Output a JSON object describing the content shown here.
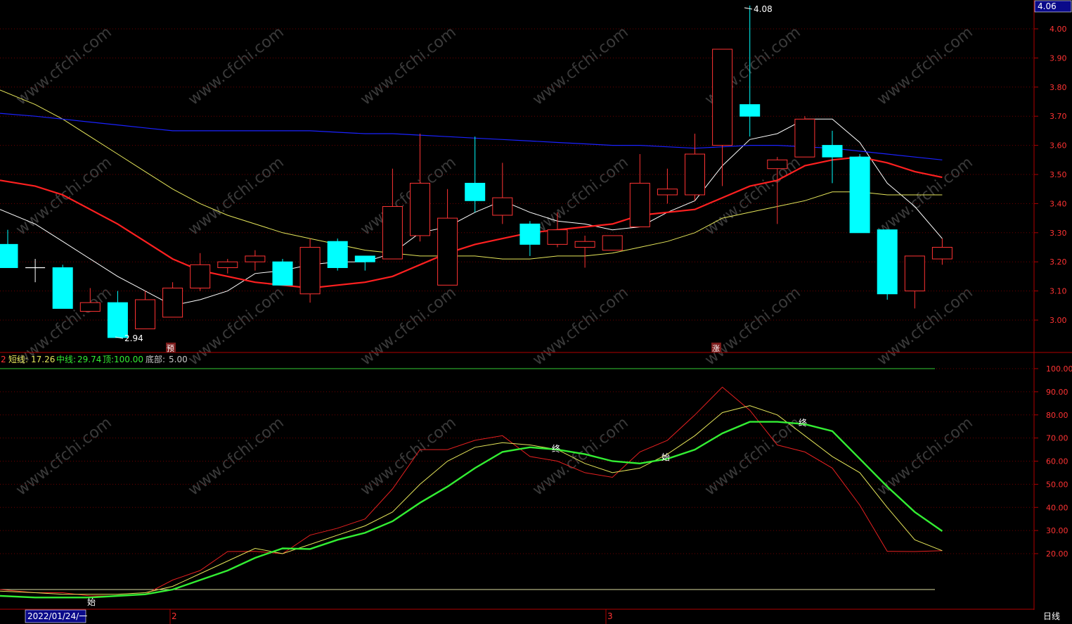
{
  "colors": {
    "up": "#ff3333",
    "down": "#00ffff",
    "grid": "#6e0000",
    "border": "#b00000",
    "axis_text": "#ff3333",
    "ma_short": "#ffffff",
    "ma_mid": "#ff2020",
    "ma_slow": "#e6e65a",
    "ma_long": "#1a22ff",
    "ind_short": "#e62020",
    "ind_mid_thin": "#e6e65a",
    "ind_mid": "#33ee33",
    "ref_top": "#33cc33",
    "ref_bottom": "#dcdca0"
  },
  "header": {
    "price_box": "4.06"
  },
  "price_panel": {
    "high_label": "4.08",
    "low_label": "2.94",
    "markers": [
      "预",
      "涨"
    ]
  },
  "indicator_panel": {
    "legend": [
      {
        "label": "2",
        "value": ""
      },
      {
        "label": "短线:",
        "value": "17.26"
      },
      {
        "label": "中线:",
        "value": "29.74"
      },
      {
        "label": "顶:",
        "value": "100.00"
      },
      {
        "label": "底部:",
        "value": "5.00"
      }
    ],
    "marks": [
      "始",
      "终",
      "始",
      "终"
    ]
  },
  "x_axis": {
    "date_box": "2022/01/24/一",
    "month_labels": [
      "2",
      "3"
    ]
  },
  "period_label": "日线",
  "watermark": "www.cfchi.com",
  "chart_data": [
    {
      "type": "candlestick",
      "ylim": [
        2.9,
        4.1
      ],
      "yticks": [
        3.0,
        3.1,
        3.2,
        3.3,
        3.4,
        3.5,
        3.6,
        3.7,
        3.8,
        3.9,
        4.0
      ],
      "candles": [
        {
          "o": 3.26,
          "c": 3.18,
          "h": 3.31,
          "l": 3.18
        },
        {
          "o": 3.18,
          "c": 3.18,
          "h": 3.21,
          "l": 3.13
        },
        {
          "o": 3.18,
          "c": 3.04,
          "h": 3.19,
          "l": 3.04
        },
        {
          "o": 3.03,
          "c": 3.06,
          "h": 3.11,
          "l": 3.03
        },
        {
          "o": 3.06,
          "c": 2.94,
          "h": 3.1,
          "l": 2.94
        },
        {
          "o": 2.97,
          "c": 3.07,
          "h": 3.1,
          "l": 2.97
        },
        {
          "o": 3.01,
          "c": 3.11,
          "h": 3.13,
          "l": 3.01
        },
        {
          "o": 3.11,
          "c": 3.19,
          "h": 3.23,
          "l": 3.1
        },
        {
          "o": 3.18,
          "c": 3.2,
          "h": 3.21,
          "l": 3.16
        },
        {
          "o": 3.2,
          "c": 3.22,
          "h": 3.24,
          "l": 3.17
        },
        {
          "o": 3.2,
          "c": 3.12,
          "h": 3.21,
          "l": 3.12
        },
        {
          "o": 3.09,
          "c": 3.25,
          "h": 3.28,
          "l": 3.06
        },
        {
          "o": 3.27,
          "c": 3.18,
          "h": 3.28,
          "l": 3.17
        },
        {
          "o": 3.22,
          "c": 3.2,
          "h": 3.22,
          "l": 3.17
        },
        {
          "o": 3.21,
          "c": 3.39,
          "h": 3.52,
          "l": 3.21
        },
        {
          "o": 3.29,
          "c": 3.47,
          "h": 3.64,
          "l": 3.27
        },
        {
          "o": 3.12,
          "c": 3.35,
          "h": 3.45,
          "l": 3.12
        },
        {
          "o": 3.47,
          "c": 3.41,
          "h": 3.63,
          "l": 3.37
        },
        {
          "o": 3.36,
          "c": 3.42,
          "h": 3.54,
          "l": 3.33
        },
        {
          "o": 3.33,
          "c": 3.26,
          "h": 3.34,
          "l": 3.22
        },
        {
          "o": 3.26,
          "c": 3.31,
          "h": 3.37,
          "l": 3.25
        },
        {
          "o": 3.25,
          "c": 3.27,
          "h": 3.29,
          "l": 3.18
        },
        {
          "o": 3.24,
          "c": 3.29,
          "h": 3.29,
          "l": 3.24
        },
        {
          "o": 3.32,
          "c": 3.47,
          "h": 3.57,
          "l": 3.32
        },
        {
          "o": 3.43,
          "c": 3.45,
          "h": 3.52,
          "l": 3.4
        },
        {
          "o": 3.43,
          "c": 3.57,
          "h": 3.64,
          "l": 3.41
        },
        {
          "o": 3.6,
          "c": 3.93,
          "h": 3.93,
          "l": 3.46
        },
        {
          "o": 3.74,
          "c": 3.7,
          "h": 4.08,
          "l": 3.63
        },
        {
          "o": 3.52,
          "c": 3.55,
          "h": 3.56,
          "l": 3.33
        },
        {
          "o": 3.56,
          "c": 3.69,
          "h": 3.7,
          "l": 3.56
        },
        {
          "o": 3.6,
          "c": 3.56,
          "h": 3.65,
          "l": 3.47
        },
        {
          "o": 3.56,
          "c": 3.3,
          "h": 3.57,
          "l": 3.3
        },
        {
          "o": 3.31,
          "c": 3.09,
          "h": 3.31,
          "l": 3.07
        },
        {
          "o": 3.1,
          "c": 3.22,
          "h": 3.22,
          "l": 3.04
        },
        {
          "o": 3.21,
          "c": 3.25,
          "h": 3.28,
          "l": 3.19
        }
      ],
      "series": [
        {
          "key": "ma_short",
          "values": [
            3.38,
            3.33,
            3.27,
            3.21,
            3.15,
            3.1,
            3.05,
            3.07,
            3.1,
            3.16,
            3.17,
            3.19,
            3.2,
            3.2,
            3.23,
            3.3,
            3.32,
            3.37,
            3.41,
            3.37,
            3.34,
            3.33,
            3.31,
            3.32,
            3.37,
            3.41,
            3.53,
            3.62,
            3.64,
            3.69,
            3.69,
            3.61,
            3.47,
            3.39,
            3.28
          ]
        },
        {
          "key": "ma_mid",
          "values": [
            3.48,
            3.46,
            3.43,
            3.38,
            3.33,
            3.27,
            3.21,
            3.17,
            3.15,
            3.13,
            3.12,
            3.11,
            3.12,
            3.13,
            3.15,
            3.19,
            3.23,
            3.26,
            3.28,
            3.3,
            3.31,
            3.32,
            3.33,
            3.36,
            3.37,
            3.38,
            3.42,
            3.46,
            3.48,
            3.53,
            3.55,
            3.56,
            3.54,
            3.51,
            3.49
          ]
        },
        {
          "key": "ma_slow",
          "values": [
            3.79,
            3.74,
            3.69,
            3.63,
            3.57,
            3.51,
            3.45,
            3.4,
            3.36,
            3.33,
            3.3,
            3.28,
            3.26,
            3.24,
            3.23,
            3.22,
            3.22,
            3.22,
            3.21,
            3.21,
            3.22,
            3.22,
            3.23,
            3.25,
            3.27,
            3.3,
            3.35,
            3.37,
            3.39,
            3.41,
            3.44,
            3.44,
            3.43,
            3.43,
            3.43
          ]
        },
        {
          "key": "ma_long",
          "values": [
            3.71,
            3.7,
            3.69,
            3.68,
            3.67,
            3.66,
            3.65,
            3.65,
            3.65,
            3.65,
            3.65,
            3.65,
            3.645,
            3.64,
            3.64,
            3.635,
            3.63,
            3.625,
            3.62,
            3.615,
            3.61,
            3.605,
            3.6,
            3.6,
            3.595,
            3.59,
            3.595,
            3.6,
            3.6,
            3.595,
            3.59,
            3.58,
            3.57,
            3.56,
            3.55
          ]
        }
      ]
    },
    {
      "type": "line",
      "ylim": [
        0,
        105
      ],
      "yticks": [
        20,
        30,
        40,
        50,
        60,
        70,
        80,
        90,
        100
      ],
      "reference_lines": [
        {
          "key": "ref_top",
          "value": 100
        },
        {
          "key": "ref_bottom",
          "value": 5
        }
      ],
      "series": [
        {
          "key": "ind_short",
          "values": [
            5,
            4,
            4,
            3,
            3,
            3.5,
            8,
            11,
            17,
            21,
            20,
            28,
            31,
            35,
            48,
            65,
            65,
            69,
            71,
            62,
            60,
            55,
            53,
            64,
            69,
            80,
            92,
            82,
            67,
            64,
            57,
            41,
            21,
            17,
            17.26
          ]
        },
        {
          "key": "ind_mid_thin",
          "values": [
            4.5,
            4,
            3.5,
            3.5,
            3.5,
            4,
            6,
            10,
            14,
            18,
            20,
            24,
            28,
            32,
            38,
            50,
            60,
            66,
            68,
            67,
            65,
            59,
            55,
            57,
            63,
            71,
            81,
            84,
            80,
            71,
            62,
            55,
            40,
            26,
            17.26
          ]
        },
        {
          "key": "ind_mid",
          "values": [
            3,
            2.5,
            2.5,
            2.5,
            3,
            3.5,
            5,
            8,
            11,
            15,
            18,
            22,
            26,
            29,
            34,
            42,
            49,
            57,
            64,
            66,
            65,
            63,
            60,
            59,
            61,
            65,
            72,
            77,
            77,
            76,
            73,
            61,
            49,
            38,
            29.74
          ]
        }
      ]
    }
  ]
}
